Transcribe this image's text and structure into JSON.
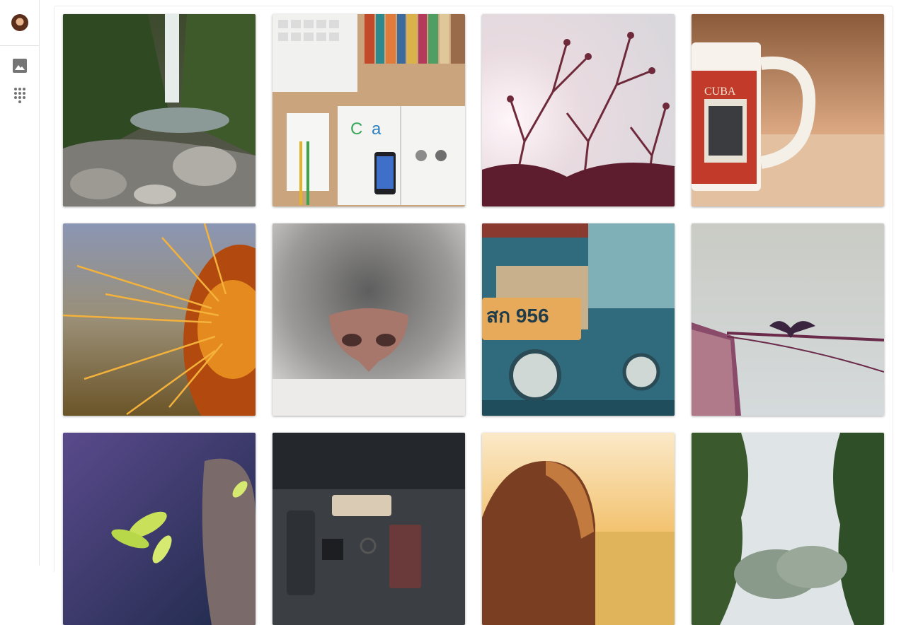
{
  "sidebar": {
    "avatar": "user-avatar",
    "items": [
      {
        "icon": "image-icon"
      },
      {
        "icon": "apps-grid-icon"
      }
    ]
  },
  "gallery": {
    "photos": [
      {
        "subject": "waterfall"
      },
      {
        "subject": "desk-with-books"
      },
      {
        "subject": "tree-branches"
      },
      {
        "subject": "mug"
      },
      {
        "subject": "cactus"
      },
      {
        "subject": "cat-nose"
      },
      {
        "subject": "tuk-tuk"
      },
      {
        "subject": "bird-on-boat"
      },
      {
        "subject": "plant"
      },
      {
        "subject": "dark-desk"
      },
      {
        "subject": "woman-sunset"
      },
      {
        "subject": "trees"
      }
    ]
  },
  "colors": {
    "rail_border": "#e4e4e4",
    "icon": "#757575"
  }
}
